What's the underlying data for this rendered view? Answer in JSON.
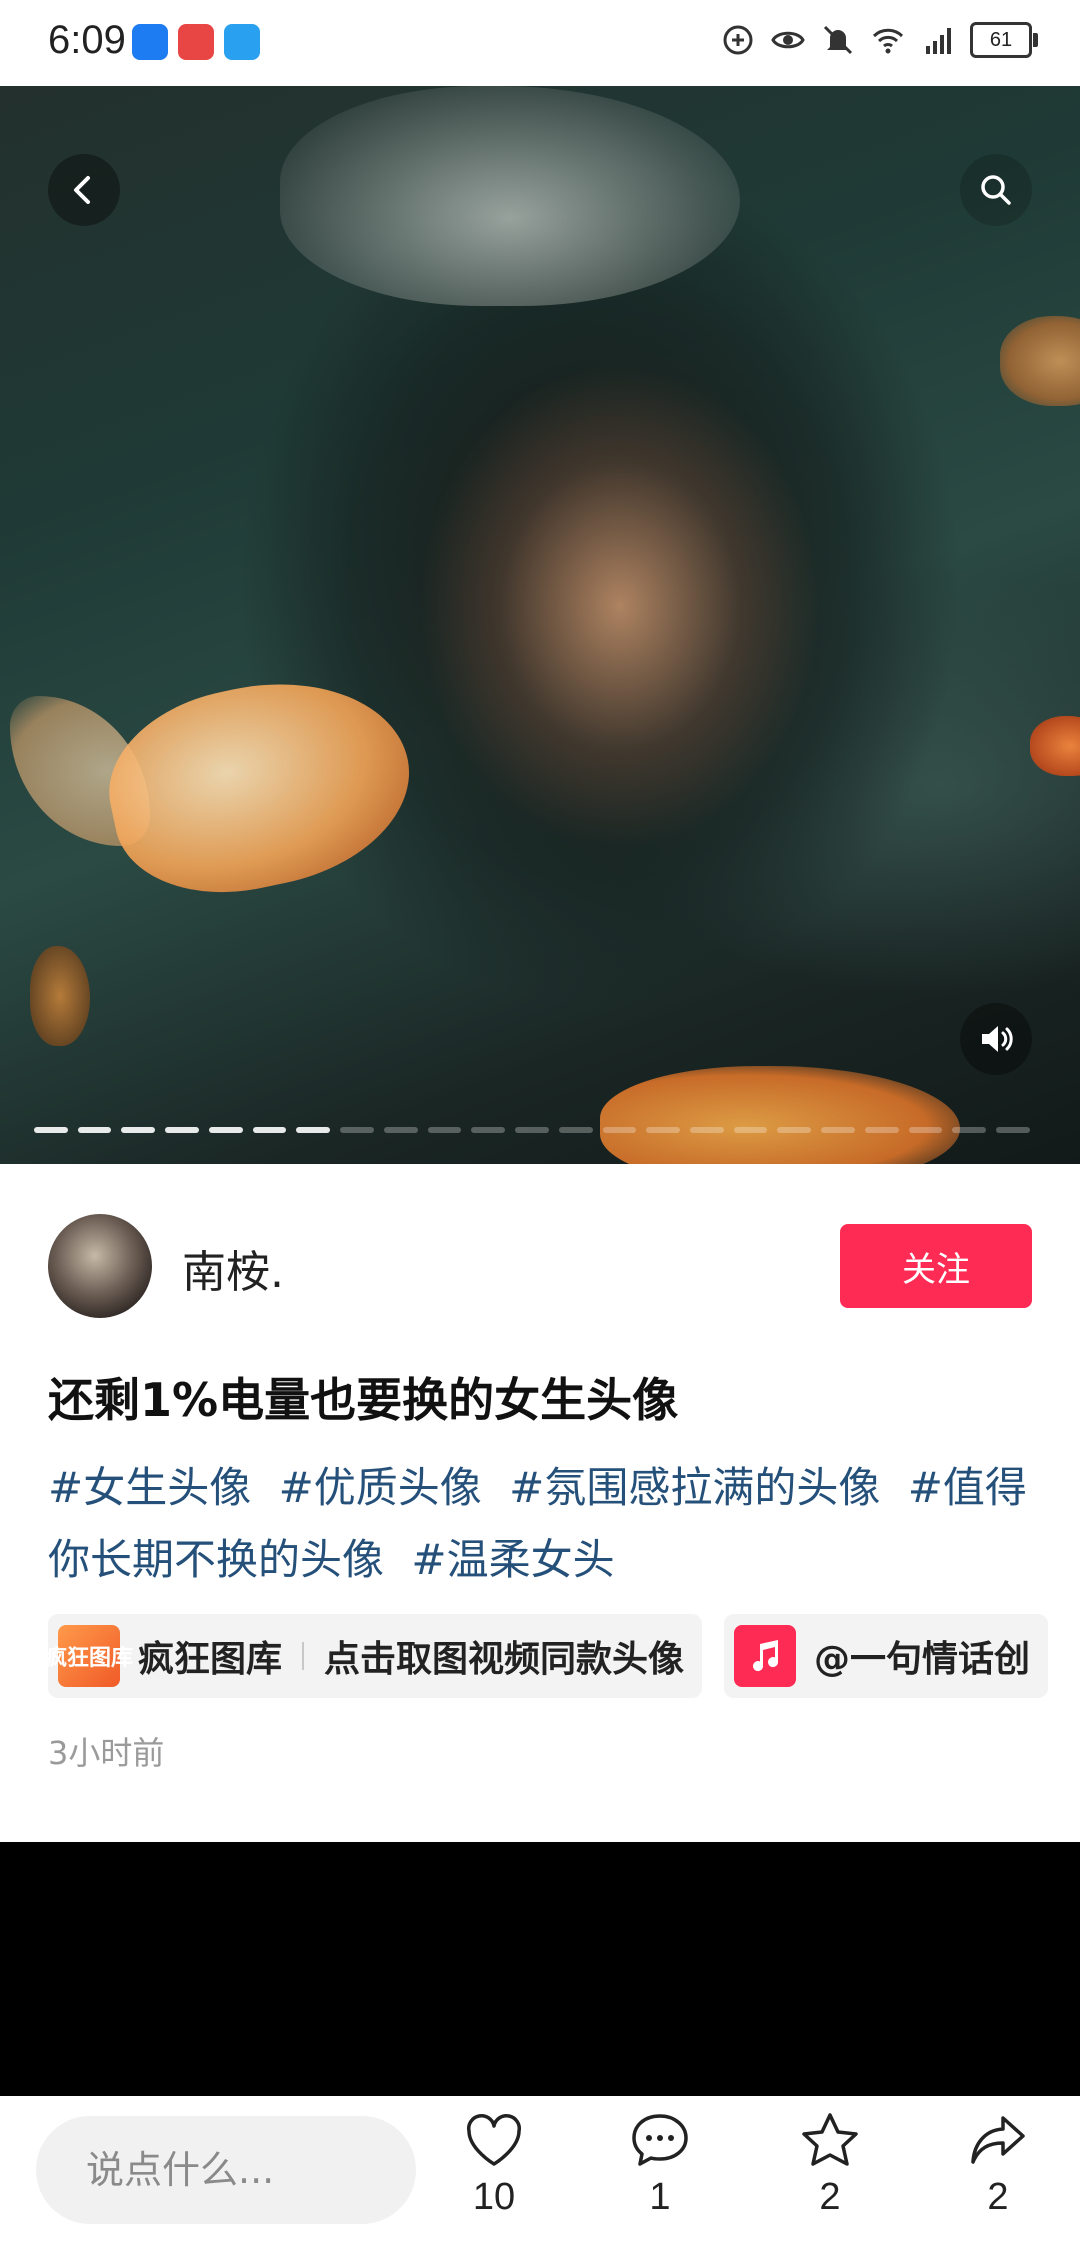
{
  "status_bar": {
    "time": "6:09",
    "battery": "61",
    "icons": [
      "tips-app-icon",
      "huawei-app-icon",
      "weather-app-icon",
      "data-saver-icon",
      "eye-comfort-icon",
      "mute-icon",
      "wifi-icon",
      "cellular-4g-icon",
      "battery-icon"
    ]
  },
  "media": {
    "page_count": 23,
    "current_page": 7,
    "icons": {
      "back": "back-icon",
      "search": "search-icon",
      "volume": "volume-icon"
    }
  },
  "author": {
    "name": "南桉.",
    "follow_label": "关注"
  },
  "post": {
    "title": "还剩1%电量也要换的女生头像",
    "tags": [
      "#女生头像",
      "#优质头像",
      "#氛围感拉满的头像",
      "#值得你长期不换的头像",
      "#温柔女头"
    ],
    "time_ago": "3小时前"
  },
  "chips": {
    "gallery": {
      "icon_text": "疯狂图库",
      "name": "疯狂图库",
      "action": "点击取图视频同款头像"
    },
    "music": {
      "label": "@一句情话创"
    }
  },
  "bottom_bar": {
    "comment_placeholder": "说点什么...",
    "likes": "10",
    "comments": "1",
    "favorites": "2",
    "shares": "2"
  },
  "colors": {
    "accent": "#fe2c55",
    "tag": "#25507a"
  }
}
